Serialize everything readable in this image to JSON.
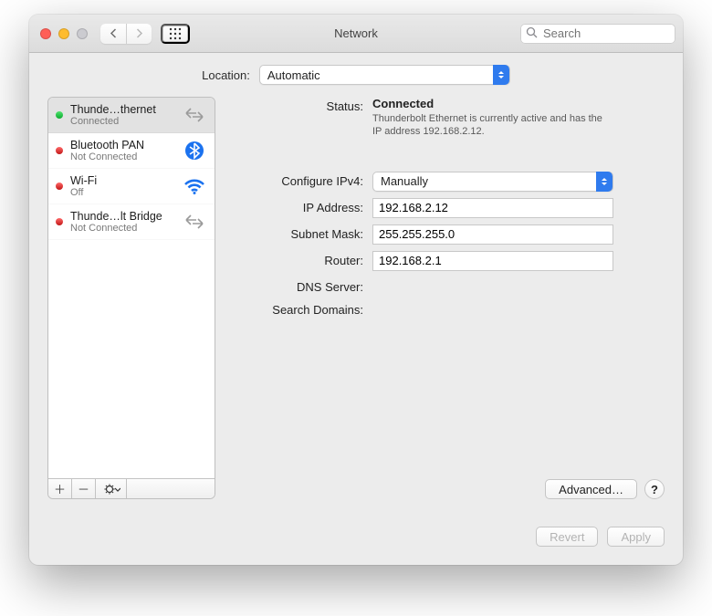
{
  "header": {
    "title": "Network",
    "search_placeholder": "Search",
    "search_value": ""
  },
  "location": {
    "label": "Location:",
    "selected": "Automatic"
  },
  "sidebar": {
    "items": [
      {
        "name": "Thunde…thernet",
        "sub": "Connected",
        "selected": true,
        "status": "green",
        "icon": "ethernet"
      },
      {
        "name": "Bluetooth PAN",
        "sub": "Not Connected",
        "selected": false,
        "status": "red",
        "icon": "bluetooth"
      },
      {
        "name": "Wi-Fi",
        "sub": "Off",
        "selected": false,
        "status": "red",
        "icon": "wifi"
      },
      {
        "name": "Thunde…lt Bridge",
        "sub": "Not Connected",
        "selected": false,
        "status": "red",
        "icon": "ethernet"
      }
    ]
  },
  "detail": {
    "labels": {
      "status": "Status:",
      "configure_ipv4": "Configure IPv4:",
      "ip_address": "IP Address:",
      "subnet_mask": "Subnet Mask:",
      "router": "Router:",
      "dns_server": "DNS Server:",
      "search_domains": "Search Domains:"
    },
    "status_value": "Connected",
    "status_desc": "Thunderbolt Ethernet is currently active and has the IP address 192.168.2.12.",
    "configure_ipv4": "Manually",
    "ip_address": "192.168.2.12",
    "subnet_mask": "255.255.255.0",
    "router": "192.168.2.1"
  },
  "buttons": {
    "advanced": "Advanced…",
    "help": "?",
    "revert": "Revert",
    "apply": "Apply"
  }
}
